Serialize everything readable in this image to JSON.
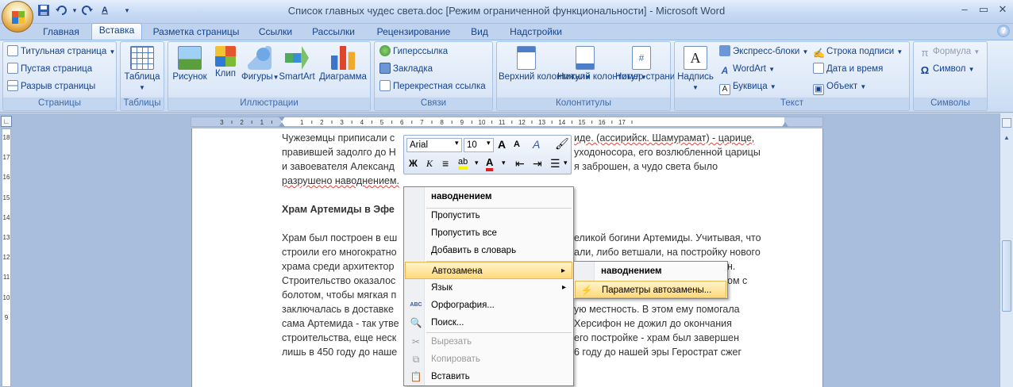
{
  "window": {
    "title": "Список главных чудес света.doc [Режим ограниченной функциональности] - Microsoft Word",
    "quick_access_icons": [
      "save-icon",
      "undo-icon",
      "redo-icon",
      "spelling-abc-icon",
      "customize-dropdown-icon"
    ],
    "controls": [
      "minimize",
      "maximize",
      "close"
    ]
  },
  "tabs": [
    "Главная",
    "Вставка",
    "Разметка страницы",
    "Ссылки",
    "Рассылки",
    "Рецензирование",
    "Вид",
    "Надстройки"
  ],
  "active_tab": "Вставка",
  "ribbon": {
    "pages": {
      "label": "Страницы",
      "items": [
        "Титульная страница",
        "Пустая страница",
        "Разрыв страницы"
      ]
    },
    "tables": {
      "label": "Таблицы",
      "items": [
        "Таблица"
      ]
    },
    "illustrations": {
      "label": "Иллюстрации",
      "items": [
        "Рисунок",
        "Клип",
        "Фигуры",
        "SmartArt",
        "Диаграмма"
      ]
    },
    "links": {
      "label": "Связи",
      "items": [
        "Гиперссылка",
        "Закладка",
        "Перекрестная ссылка"
      ]
    },
    "headers": {
      "label": "Колонтитулы",
      "items": [
        "Верхний колонтитул",
        "Нижний колонтитул",
        "Номер страницы"
      ]
    },
    "text": {
      "label": "Текст",
      "items": [
        "Надпись",
        "Экспресс-блоки",
        "WordArt",
        "Буквица",
        "Строка подписи",
        "Дата и время",
        "Объект"
      ]
    },
    "symbols": {
      "label": "Символы",
      "items": [
        "Формула",
        "Символ"
      ]
    },
    "ribbon_tiles": {
      "v": "▼",
      "a1": "■",
      "a2": "□",
      "a3": "↵",
      "a4": "#",
      "a5": "A",
      "a6": "W",
      "a7": "A",
      "a8": "✍",
      "a9": "▣",
      "a10": "π",
      "a11": "Ω",
      "a12": "▾"
    }
  },
  "ruler": {
    "numbers": [
      "3",
      "2",
      "1",
      "1",
      "2",
      "3",
      "4",
      "5",
      "6",
      "7",
      "8",
      "9",
      "10",
      "11",
      "12",
      "13",
      "14",
      "15",
      "16",
      "17"
    ],
    "v_numbers": [
      "18",
      "17",
      "16",
      "15",
      "14",
      "13",
      "12",
      "11",
      "10",
      "9"
    ]
  },
  "document": {
    "para1": [
      "Чужеземцы приписали с",
      "иде. (ассирийск. Шамурамат) - царице,",
      "правившей задолго до Н",
      "уходоносора, его возлюбленной царицы",
      "и завоевателя Александ",
      "я заброшен, а чудо света было",
      "разрушено наводнением."
    ],
    "heading": "Храм Артемиды в Эфе",
    "para2": [
      "Храм был построен в еш",
      "еликой богини Артемиды. Учитывая, что",
      "строили его многократно",
      "али, либо ветшали, на постройку нового",
      "храма среди архитектор",
      "н.",
      "Строительство оказалос",
      "ом с",
      "болотом, чтобы мягкая п",
      "заключалась в доставке",
      "ую местность. В этом ему помогала",
      "сама Артемида - так утве",
      "Херсифон не дожил до окончания",
      "строительства, еще неск",
      "его постройке - храм был завершен",
      "лишь в 450 году до наше",
      "6 году до нашей эры Герострат сжег"
    ]
  },
  "mini_toolbar": {
    "font": "Arial",
    "size": "10",
    "buttons": [
      "grow-font-icon",
      "shrink-font-icon",
      "styles-icon",
      "format-painter-icon",
      "bold-icon",
      "italic-icon",
      "center-icon",
      "highlight-icon",
      "font-color-icon",
      "decrease-indent-icon",
      "increase-indent-icon",
      "bullets-icon"
    ],
    "glyphs": {
      "grow": "A",
      "shrink": "A",
      "styles": "A",
      "paint": "🖌",
      "bold": "Ж",
      "italic": "К",
      "align": "≡",
      "hl": "ab",
      "color": "A",
      "dec": "⇤",
      "inc": "⇥",
      "bullets": "☰",
      "dd": "▾"
    }
  },
  "context_menu": {
    "suggestion": "наводнением",
    "items": {
      "ignore": "Пропустить",
      "ignore_all": "Пропустить все",
      "add_dictionary": "Добавить в словарь",
      "autocorrect": "Автозамена",
      "language": "Язык",
      "spelling": "Орфография...",
      "lookup": "Поиск...",
      "cut": "Вырезать",
      "copy": "Копировать",
      "paste": "Вставить"
    },
    "submenu": {
      "suggestion": "наводнением",
      "options": "Параметры автозамены..."
    },
    "glyphs": {
      "arrow": "▸",
      "spell": "ABC",
      "lookup": "🔍",
      "cut": "✂",
      "copy": "⧉",
      "paste": "📋",
      "ac": "⚡"
    }
  }
}
